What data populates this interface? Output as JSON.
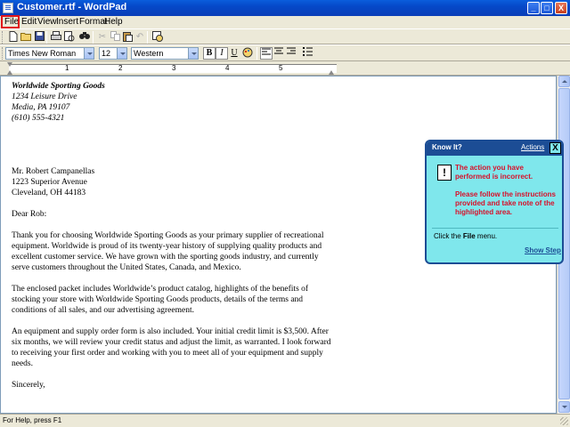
{
  "window": {
    "title": "Customer.rtf - WordPad",
    "minimize": "_",
    "maximize": "□",
    "close": "X"
  },
  "menu": {
    "items": [
      "File",
      "Edit",
      "View",
      "Insert",
      "Format",
      "Help"
    ]
  },
  "format_bar": {
    "font_name": "Times New Roman",
    "font_size": "12",
    "script": "Western",
    "bold": "B",
    "italic": "I",
    "underline": "U"
  },
  "ruler": {
    "numbers": [
      "1",
      "2",
      "3",
      "4",
      "5"
    ]
  },
  "document": {
    "company": "Worldwide Sporting Goods",
    "address1": "1234 Leisure Drive",
    "address2": "Media, PA 19107",
    "phone": "(610) 555-4321",
    "recipient_name": "Mr. Robert Campanellas",
    "recipient_street": "1223 Superior Avenue",
    "recipient_city": "Cleveland, OH  44183",
    "salutation": "Dear Rob:",
    "p1": [
      "Thank you for choosing Worldwide Sporting Goods as your primary supplier of recreational",
      "equipment. Worldwide is proud of its twenty-year history of supplying quality products and",
      "excellent customer service. We have grown with the sporting goods industry, and currently",
      "serve customers throughout the United States, Canada, and Mexico."
    ],
    "p2": [
      "The enclosed packet includes Worldwide’s product catalog, highlights of the benefits of",
      "stocking your store with Worldwide Sporting Goods products, details of the terms and",
      "conditions of all sales, and our advertising agreement."
    ],
    "p3": [
      "An equipment and supply order form is also included. Your initial credit limit is $3,500. After",
      "six months, we will review your credit status and adjust the limit, as warranted. I look forward",
      "to receiving your first order and working with you to meet all of your equipment and supply",
      "needs."
    ],
    "closing": "Sincerely,"
  },
  "status": {
    "text": "For Help, press F1"
  },
  "knowit": {
    "title": "Know It?",
    "actions": "Actions",
    "close": "X",
    "alert_icon": "!",
    "msg1": "The action you have performed is incorrect.",
    "msg2": "Please follow the instructions provided and take note of the highlighted area.",
    "instr_prefix": "Click the ",
    "instr_target": "File",
    "instr_suffix": " menu.",
    "show_step": "Show Step"
  }
}
